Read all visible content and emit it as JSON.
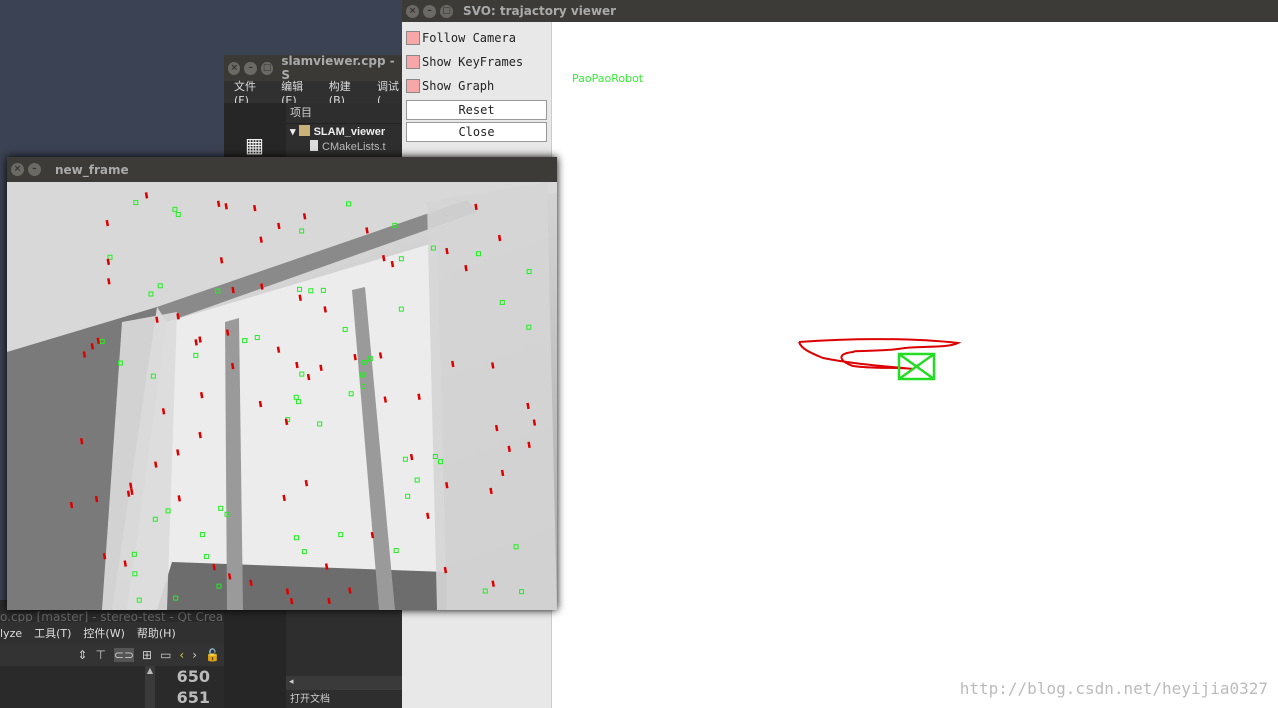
{
  "qt_creator": {
    "title": "slamviewer.cpp - S",
    "menu": [
      "文件(F)",
      "编辑(E)",
      "构建(B)",
      "调试("
    ],
    "tree_header": "项目",
    "tree_items": [
      "SLAM_viewer",
      "CMakeLists.t"
    ]
  },
  "qt_creator_2": {
    "title": "o.cpp [master] - stereo-test - Qt Crea",
    "menu": [
      "lyze",
      "工具(T)",
      "控件(W)",
      "帮助(H)"
    ],
    "line_numbers": [
      "650",
      "651"
    ],
    "open_docs": "打开文档"
  },
  "new_frame": {
    "title": "new_frame"
  },
  "svo": {
    "title": "SVO: trajactory viewer",
    "checkboxes": [
      {
        "label": "Follow Camera",
        "checked": false
      },
      {
        "label": "Show KeyFrames",
        "checked": false
      },
      {
        "label": "Show Graph",
        "checked": false
      }
    ],
    "reset_label": "Reset",
    "close_label": "Close",
    "robot_label": "PaoPaoRobot",
    "trajectory_color": "#dd0000",
    "camera_color": "#22dd22"
  },
  "watermark": "http://blog.csdn.net/heyijia0327"
}
